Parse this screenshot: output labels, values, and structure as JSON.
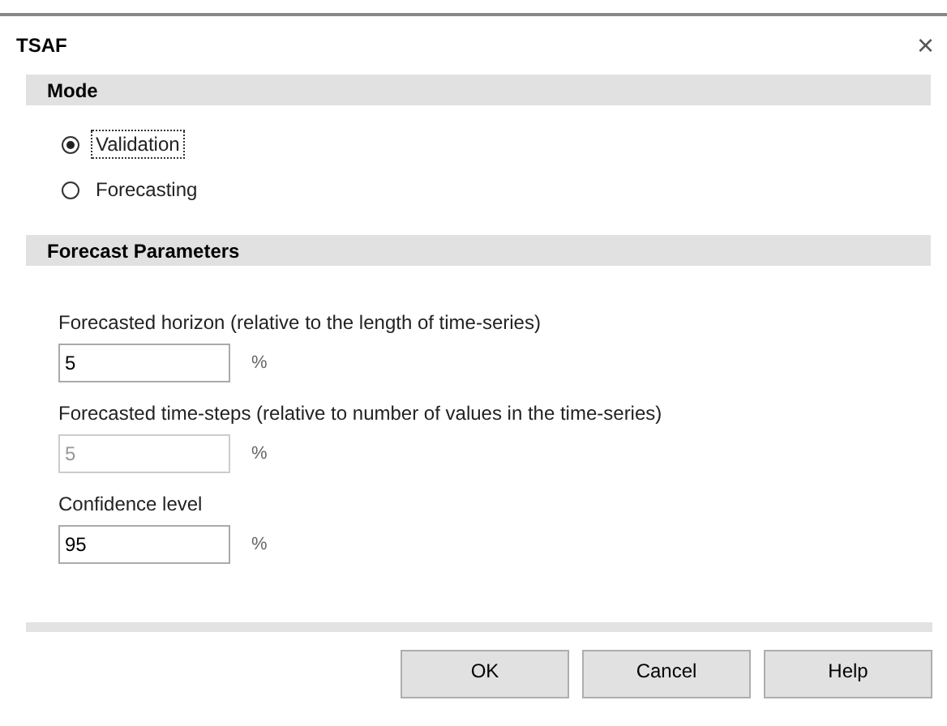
{
  "window": {
    "title": "TSAF",
    "close": "×"
  },
  "mode": {
    "heading": "Mode",
    "options": [
      {
        "label": "Validation",
        "selected": true,
        "focused": true
      },
      {
        "label": "Forecasting",
        "selected": false,
        "focused": false
      }
    ]
  },
  "parameters": {
    "heading": "Forecast Parameters",
    "fields": [
      {
        "label": "Forecasted horizon (relative to the length of time-series)",
        "value": "5",
        "unit": "%",
        "disabled": false
      },
      {
        "label": "Forecasted time-steps (relative to number of values in the time-series)",
        "value": "5",
        "unit": "%",
        "disabled": true
      },
      {
        "label": "Confidence level",
        "value": "95",
        "unit": "%",
        "disabled": false
      }
    ]
  },
  "buttons": [
    "OK",
    "Cancel",
    "Help"
  ]
}
